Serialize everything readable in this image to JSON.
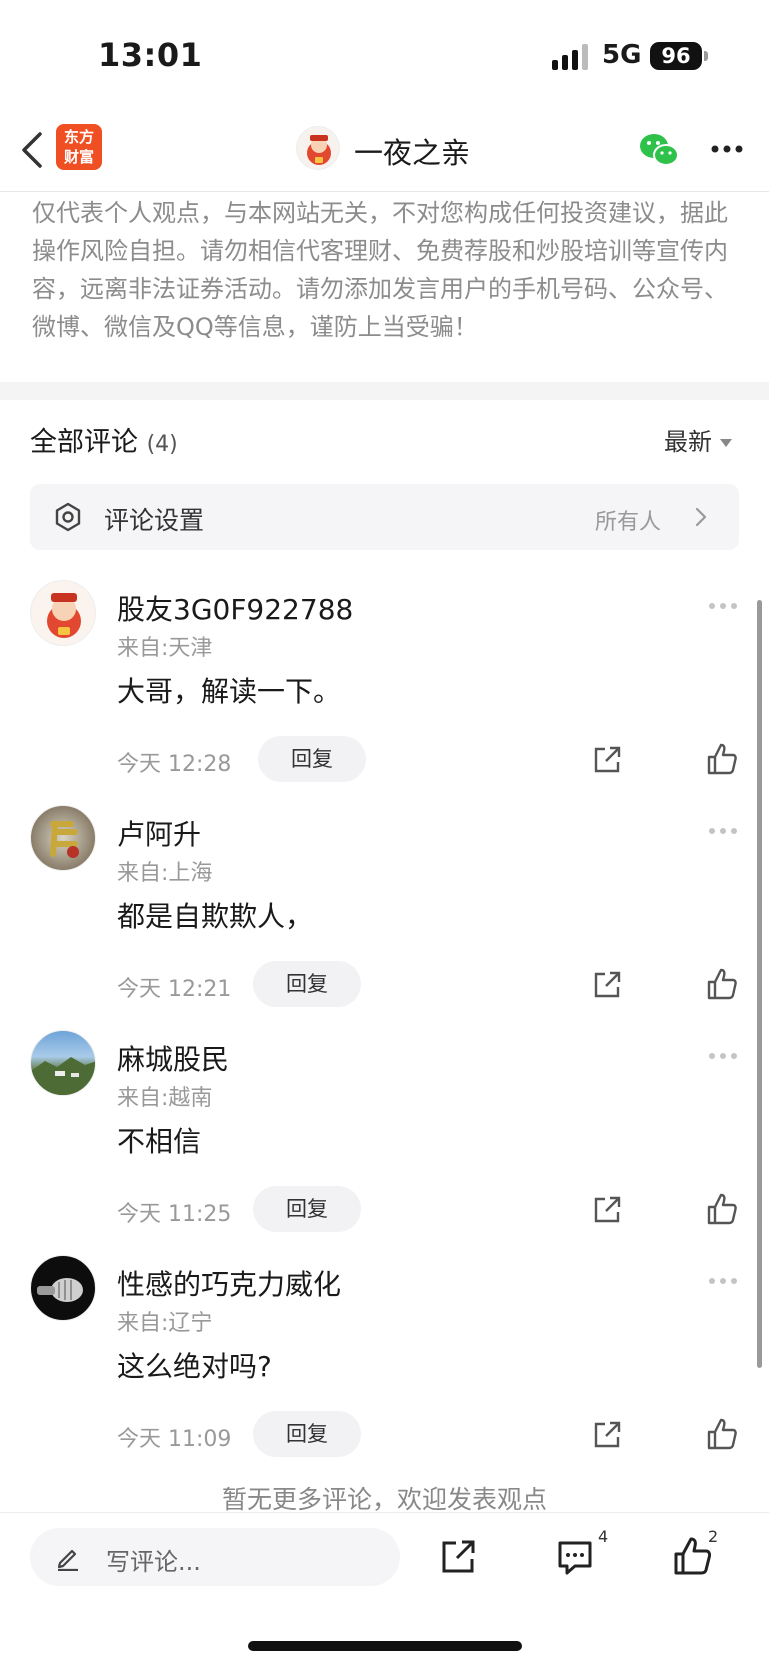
{
  "status_bar": {
    "time": "13:01",
    "network": "5G",
    "battery": "96"
  },
  "nav": {
    "logo_line1": "东方",
    "logo_line2": "财富",
    "title": "一夜之亲"
  },
  "disclaimer": "仅代表个人观点，与本网站无关，不对您构成任何投资建议，据此操作风险自担。请勿相信代客理财、免费荐股和炒股培训等宣传内容，远离非法证券活动。请勿添加发言用户的手机号码、公众号、微博、微信及QQ等信息，谨防上当受骗！",
  "comments_header": {
    "title": "全部评论",
    "count": "(4)",
    "sort": "最新"
  },
  "settings": {
    "label": "评论设置",
    "value": "所有人"
  },
  "comments": [
    {
      "name": "股友3G0F922788",
      "location": "来自:天津",
      "text": "大哥，解读一下。",
      "time": "今天 12:28",
      "reply": "回复"
    },
    {
      "name": "卢阿升",
      "location": "来自:上海",
      "text": "都是自欺欺人，",
      "time": "今天 12:21",
      "reply": "回复"
    },
    {
      "name": "麻城股民",
      "location": "来自:越南",
      "text": "不相信",
      "time": "今天 11:25",
      "reply": "回复"
    },
    {
      "name": "性感的巧克力威化",
      "location": "来自:辽宁",
      "text": "这么绝对吗?",
      "time": "今天 11:09",
      "reply": "回复"
    }
  ],
  "footer_note": "暂无更多评论，欢迎发表观点",
  "bottom_bar": {
    "placeholder": "写评论...",
    "comment_count": "4",
    "like_count": "2"
  },
  "colors": {
    "brand": "#f04e23",
    "wechat": "#2ec24a"
  }
}
